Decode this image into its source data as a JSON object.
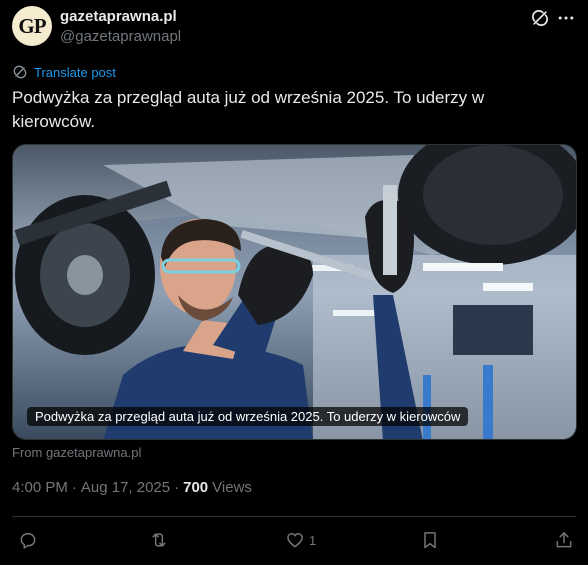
{
  "author": {
    "avatar_text": "GP",
    "name": "gazetaprawna.pl",
    "handle": "@gazetaprawnapl"
  },
  "icons": {
    "grok": "grok-icon",
    "more": "more-icon",
    "translate": "translate-icon",
    "reply": "reply-icon",
    "repost": "repost-icon",
    "like": "like-icon",
    "bookmark": "bookmark-icon",
    "share": "share-icon"
  },
  "translate_label": "Translate post",
  "post_text": "Podwyżka za przegląd auta już od września 2025. To uderzy w kierowców.",
  "media": {
    "caption": "Podwyżka za przegląd auta już od września 2025. To uderzy w kierowców"
  },
  "from_text": "From gazetaprawna.pl",
  "meta": {
    "time": "4:00 PM",
    "date": "Aug 17, 2025",
    "sep": "·",
    "views_count": "700",
    "views_label": "Views"
  },
  "actions": {
    "likes": "1"
  },
  "colors": {
    "accent": "#1d9bf0",
    "muted": "#71767b",
    "text": "#e7e9ea",
    "background": "#000000"
  }
}
